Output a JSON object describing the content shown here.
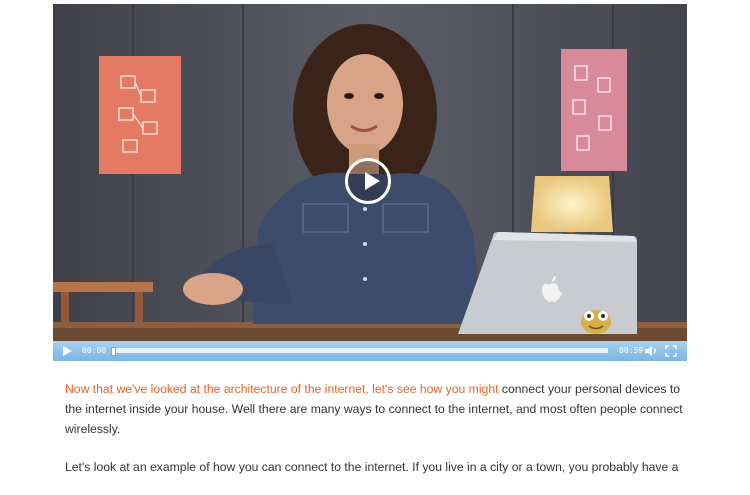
{
  "video": {
    "current_time": "00:00",
    "duration": "00:59",
    "progress_fraction": 0.0,
    "icons": {
      "play": "play-icon",
      "big_play": "big-play-icon",
      "volume": "speaker-icon",
      "fullscreen": "fullscreen-icon",
      "watermark": "frog-logo-icon"
    }
  },
  "article": {
    "p1_highlight": "Now that we've looked at the architecture of the internet, let's see how you might",
    "p1_rest": " connect your personal devices to the internet inside your house. Well there are many ways to connect to the internet, and most often people connect wirelessly.",
    "p2": "Let's look at an example of how you can connect to the internet. If you live in a city or a town, you probably have a"
  },
  "colors": {
    "highlight": "#e8632a",
    "control_bar": "#8ec2ea",
    "text": "#333333"
  }
}
